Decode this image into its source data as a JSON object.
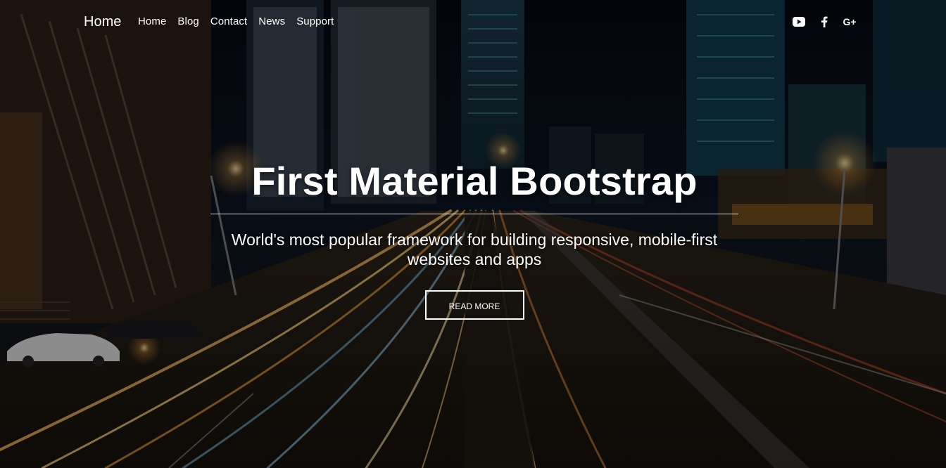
{
  "navbar": {
    "brand": "Home",
    "links": [
      "Home",
      "Blog",
      "Contact",
      "News",
      "Support"
    ],
    "social": [
      {
        "icon": "youtube-icon"
      },
      {
        "icon": "facebook-icon"
      },
      {
        "icon": "google-plus-icon",
        "glyph": "G+"
      }
    ]
  },
  "hero": {
    "title": "First Material Bootstrap",
    "subtitle": "World's most popular framework for building responsive, mobile-first websites and apps",
    "button_label": "READ MORE"
  },
  "colors": {
    "text": "#ffffff",
    "overlay": "rgba(0,0,0,0.35)",
    "accent_light_trail": "#f0b060",
    "accent_city_glow": "#3bb6c9"
  }
}
